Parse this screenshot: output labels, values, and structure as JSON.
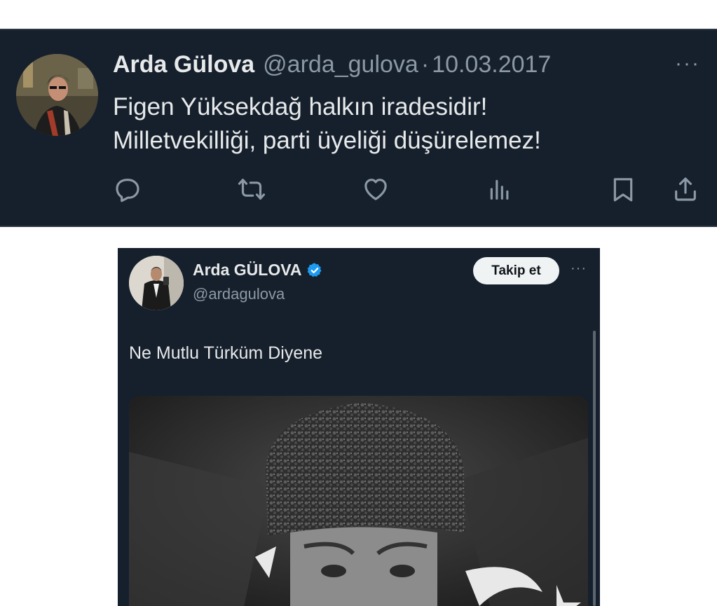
{
  "tweet_top": {
    "author_name": "Arda Gülova",
    "handle": "@arda_gulova",
    "separator": "·",
    "date": "10.03.2017",
    "more_label": "···",
    "text_lines": [
      "Figen Yüksekdağ halkın iradesidir!",
      "Milletvekilliği, parti üyeliği düşürelemez!"
    ],
    "actions": [
      "reply-icon",
      "retweet-icon",
      "like-icon",
      "views-icon",
      "bookmark-icon",
      "share-icon"
    ]
  },
  "tweet_embedded": {
    "author_name": "Arda GÜLOVA",
    "handle": "@ardagulova",
    "verified": true,
    "follow_label": "Takip et",
    "more_label": "···",
    "text": "Ne Mutlu Türküm Diyene",
    "media": "black-and-white portrait photo with fur hat and crescent-star flag"
  },
  "colors": {
    "background": "#16202c",
    "text_primary": "#e7e9ea",
    "text_secondary": "#8b98a5",
    "verified_blue": "#1d9bf0",
    "follow_button": "#eff3f4"
  }
}
